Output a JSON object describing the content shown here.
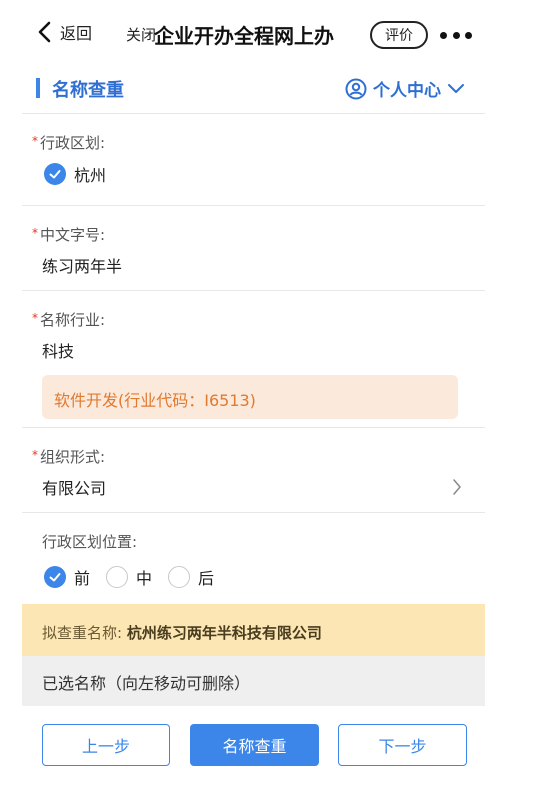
{
  "nav": {
    "back_label": "返回",
    "close_label": "关闭",
    "title": "企业开办全程网上办",
    "rate_label": "评价"
  },
  "header": {
    "title": "名称查重",
    "user_center_label": "个人中心"
  },
  "form": {
    "region": {
      "label": "行政区划:",
      "value": "杭州",
      "checked": true
    },
    "chinese_name": {
      "label": "中文字号:",
      "value": "练习两年半"
    },
    "industry": {
      "label": "名称行业:",
      "value": "科技",
      "suggestion": "软件开发(行业代码：I6513)"
    },
    "org_form": {
      "label": "组织形式:",
      "value": "有限公司"
    },
    "region_position": {
      "label": "行政区划位置:",
      "options": [
        {
          "label": "前",
          "selected": true
        },
        {
          "label": "中",
          "selected": false
        },
        {
          "label": "后",
          "selected": false
        }
      ]
    }
  },
  "proposed": {
    "prefix": "拟查重名称: ",
    "name": "杭州练习两年半科技有限公司"
  },
  "selected_names_label": "已选名称（向左移动可删除）",
  "buttons": {
    "prev": "上一步",
    "check": "名称查重",
    "next": "下一步"
  },
  "colors": {
    "accent": "#3b86e8",
    "required": "#e3371e",
    "suggestion_bg": "#fbe9dc",
    "suggestion_text": "#e07a2f",
    "proposed_bg": "#fbe6b4"
  }
}
